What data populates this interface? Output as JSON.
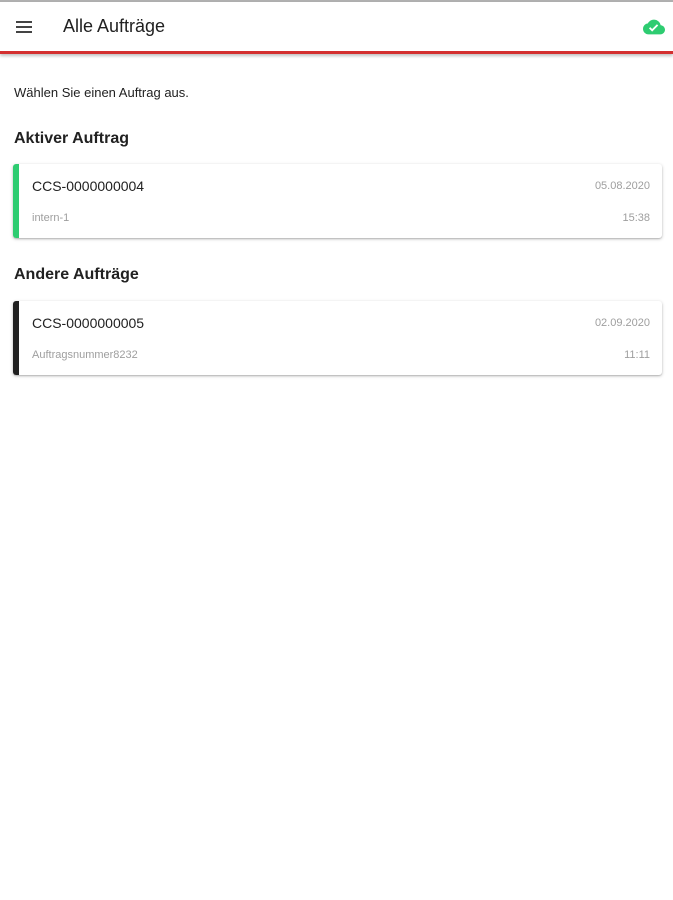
{
  "appbar": {
    "title": "Alle Aufträge",
    "menu_icon": "menu-icon",
    "sync_icon": "cloud-done-icon",
    "sync_color": "#2ecc71",
    "accent_color": "#d32f2f"
  },
  "hint": "Wählen Sie einen Auftrag aus.",
  "active_section": {
    "title": "Aktiver Auftrag",
    "orders": [
      {
        "number": "CCS-0000000004",
        "date": "05.08.2020",
        "sub": "intern-1",
        "time": "15:38",
        "accent": "#2ecc71"
      }
    ]
  },
  "other_section": {
    "title": "Andere Aufträge",
    "orders": [
      {
        "number": "CCS-0000000005",
        "date": "02.09.2020",
        "sub": "Auftragsnummer8232",
        "time": "11:11",
        "accent": "#212121"
      }
    ]
  }
}
